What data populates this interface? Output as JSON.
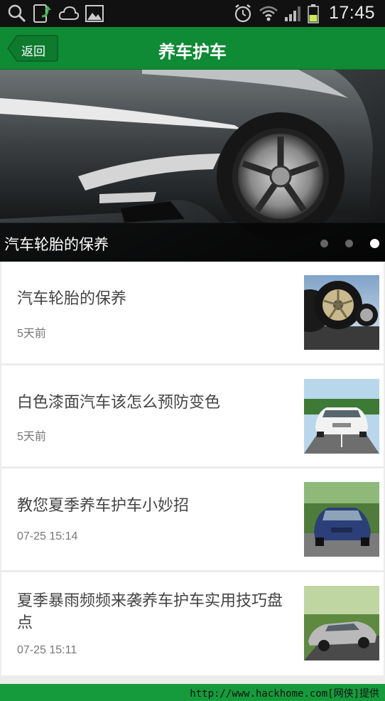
{
  "status_bar": {
    "time": "17:45",
    "icons": [
      "search-icon",
      "download-icon",
      "cloud-icon",
      "image-icon",
      "alarm-icon",
      "wifi-icon",
      "signal-icon",
      "battery-icon"
    ]
  },
  "header": {
    "back_label": "返回",
    "title": "养车护车"
  },
  "hero": {
    "caption": "汽车轮胎的保养",
    "slide_count": 3,
    "active_slide": 3
  },
  "articles": [
    {
      "title": "汽车轮胎的保养",
      "time": "5天前",
      "thumb": "tire-image"
    },
    {
      "title": "白色漆面汽车该怎么预防变色",
      "time": "5天前",
      "thumb": "white-car-image"
    },
    {
      "title": "教您夏季养车护车小妙招",
      "time": "07-25 15:14",
      "thumb": "blue-car-image"
    },
    {
      "title": "夏季暴雨频频来袭养车护车实用技巧盘点",
      "time": "07-25 15:11",
      "thumb": "silver-car-image"
    }
  ],
  "footer": {
    "watermark": "http://www.hackhome.com[网侠]提供"
  },
  "colors": {
    "header_green": "#0f8a35",
    "bottom_green": "#169b3c"
  }
}
